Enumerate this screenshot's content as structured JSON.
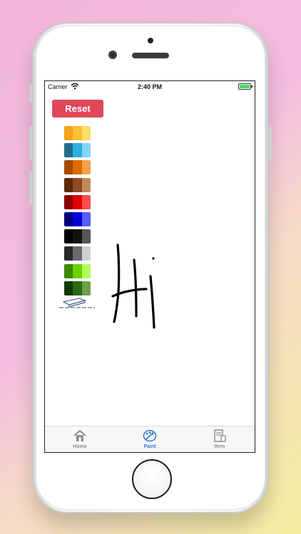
{
  "status_bar": {
    "carrier": "Carrier",
    "time": "2:40 PM"
  },
  "toolbar": {
    "reset_label": "Reset"
  },
  "palette": {
    "colors": [
      {
        "name": "orange-yellow",
        "shades": [
          "#f6a21d",
          "#fbc02d",
          "#f9e066"
        ]
      },
      {
        "name": "cyan-blue",
        "shades": [
          "#1f6f8b",
          "#2bb0e0",
          "#7fd6f5"
        ]
      },
      {
        "name": "orange-brown",
        "shades": [
          "#a34a00",
          "#e06a00",
          "#f7a04a"
        ]
      },
      {
        "name": "brown",
        "shades": [
          "#5a2a0e",
          "#8b4a1f",
          "#c28a5a"
        ]
      },
      {
        "name": "red",
        "shades": [
          "#8a0000",
          "#e00000",
          "#ff4a4a"
        ]
      },
      {
        "name": "blue",
        "shades": [
          "#00007a",
          "#0000d6",
          "#5a5aff"
        ]
      },
      {
        "name": "black",
        "shades": [
          "#000000",
          "#111111",
          "#555555"
        ]
      },
      {
        "name": "gray",
        "shades": [
          "#2a2a2a",
          "#6a6a6a",
          "#cfcfcf"
        ]
      },
      {
        "name": "green",
        "shades": [
          "#3a8a00",
          "#6ad400",
          "#b0ff5a"
        ]
      },
      {
        "name": "dark-green",
        "shades": [
          "#0f3a00",
          "#2a6a10",
          "#6aa04a"
        ]
      }
    ],
    "eraser_icon": "eraser-icon"
  },
  "drawing": {
    "stroke_color": "#000000"
  },
  "tab_bar": {
    "active_color": "#2f7fd8",
    "inactive_color": "#8e8e93",
    "tabs": [
      {
        "label": "Home",
        "icon": "house-icon",
        "active": false
      },
      {
        "label": "Paint",
        "icon": "palette-icon",
        "active": true
      },
      {
        "label": "Item",
        "icon": "register-icon",
        "active": false
      }
    ]
  }
}
